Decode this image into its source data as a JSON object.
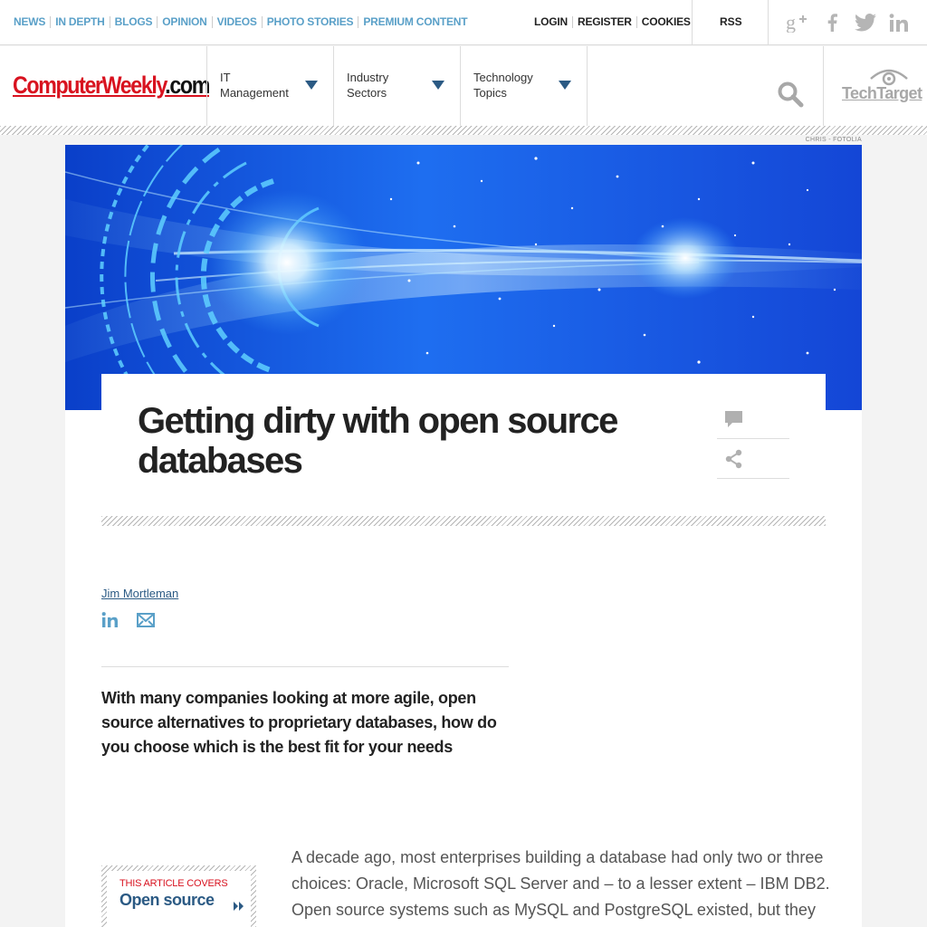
{
  "top_nav": [
    "NEWS",
    "IN DEPTH",
    "BLOGS",
    "OPINION",
    "VIDEOS",
    "PHOTO STORIES",
    "PREMIUM CONTENT"
  ],
  "account": [
    "LOGIN",
    "REGISTER",
    "COOKIES"
  ],
  "rss": "RSS",
  "social_icons": [
    "google-plus-icon",
    "facebook-icon",
    "twitter-icon",
    "linkedin-icon"
  ],
  "logo": {
    "name": "ComputerWeekly",
    "suffix": ".com"
  },
  "menus": [
    {
      "label": "IT Management"
    },
    {
      "label": "Industry Sectors"
    },
    {
      "label": "Technology Topics"
    }
  ],
  "techtarget": "TechTarget",
  "image_credit": "CHRIS - FOTOLIA",
  "article": {
    "title": "Getting dirty with open source databases",
    "author": "Jim Mortleman",
    "lead": "With many companies looking at more agile, open source alternatives to proprietary databases, how do you choose which is the best fit for your needs",
    "covers_label": "THIS ARTICLE COVERS",
    "covers_topic": "Open source",
    "body": "A decade ago, most enterprises building a database had only two or three choices: Oracle, Microsoft SQL Server and – to a lesser extent – IBM DB2. Open source systems such as MySQL and PostgreSQL existed, but they"
  },
  "colors": {
    "brand_red": "#d8121f",
    "nav_blue": "#5aa0c8",
    "dark_blue": "#2b5a84"
  }
}
